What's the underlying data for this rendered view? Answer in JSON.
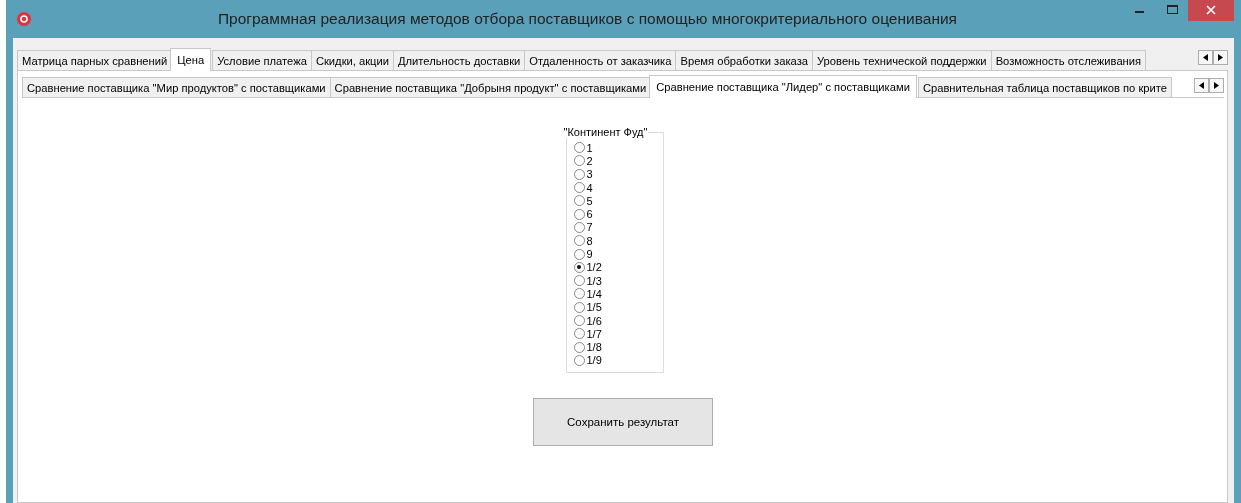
{
  "window": {
    "title": "Программная реализация методов отбора поставщиков с помощью многокритериального оценивания"
  },
  "tabs": [
    {
      "label": "Матрица парных сравнений",
      "selected": false
    },
    {
      "label": "Цена",
      "selected": true
    },
    {
      "label": "Условие платежа",
      "selected": false
    },
    {
      "label": "Скидки, акции",
      "selected": false
    },
    {
      "label": "Длительность доставки",
      "selected": false
    },
    {
      "label": "Отдаленность от заказчика",
      "selected": false
    },
    {
      "label": "Время обработки заказа",
      "selected": false
    },
    {
      "label": "Уровень технической поддержки",
      "selected": false
    },
    {
      "label": "Возможность отслеживания",
      "selected": false
    }
  ],
  "subtabs": [
    {
      "label": "Сравнение поставщика \"Мир продуктов\" с поставщиками",
      "selected": false
    },
    {
      "label": "Сравнение поставщика \"Добрыня продукт\" с поставщиками",
      "selected": false
    },
    {
      "label": "Сравнение поставщика \"Лидер\" с поставщиками",
      "selected": true
    },
    {
      "label": "Сравнительная таблица поставщиков по крите",
      "selected": false
    }
  ],
  "group": {
    "title": "\"Континент Фуд\"",
    "options": [
      {
        "label": "1",
        "selected": false
      },
      {
        "label": "2",
        "selected": false
      },
      {
        "label": "3",
        "selected": false
      },
      {
        "label": "4",
        "selected": false
      },
      {
        "label": "5",
        "selected": false
      },
      {
        "label": "6",
        "selected": false
      },
      {
        "label": "7",
        "selected": false
      },
      {
        "label": "8",
        "selected": false
      },
      {
        "label": "9",
        "selected": false
      },
      {
        "label": "1/2",
        "selected": true
      },
      {
        "label": "1/3",
        "selected": false
      },
      {
        "label": "1/4",
        "selected": false
      },
      {
        "label": "1/5",
        "selected": false
      },
      {
        "label": "1/6",
        "selected": false
      },
      {
        "label": "1/7",
        "selected": false
      },
      {
        "label": "1/8",
        "selected": false
      },
      {
        "label": "1/9",
        "selected": false
      }
    ]
  },
  "save_button": "Сохранить результат"
}
